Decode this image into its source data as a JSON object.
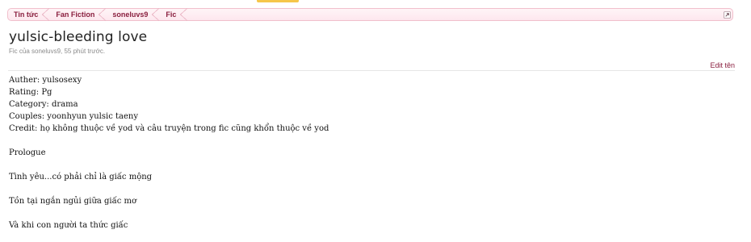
{
  "breadcrumb": {
    "items": [
      {
        "label": "Tin tức"
      },
      {
        "label": "Fan Fiction"
      },
      {
        "label": "soneluvs9"
      },
      {
        "label": "Fic"
      }
    ]
  },
  "thread": {
    "title": "yulsic-bleeding love",
    "meta": "Fic của soneluvs9, 55 phút trước.",
    "edit_label": "Edit tên"
  },
  "post": {
    "info_lines": [
      "Auther: yulsosexy",
      "Rating: Pg",
      "Category: drama",
      "Couples: yoonhyun yulsic taeny",
      "Credit: họ không thuộc về yod và câu truyện trong fic cũng khổn thuộc về yod"
    ],
    "prologue": "Prologue",
    "paragraphs": [
      "Tình yêu...có phải chỉ là giấc mộng",
      "Tồn tại ngắn ngủi giữa giấc mơ",
      "Và khi con người ta thức giấc"
    ]
  },
  "colors": {
    "accent": "#8a1f3f",
    "breadcrumb_bg": "#fde7ee",
    "breadcrumb_border": "#f1bfcc"
  }
}
